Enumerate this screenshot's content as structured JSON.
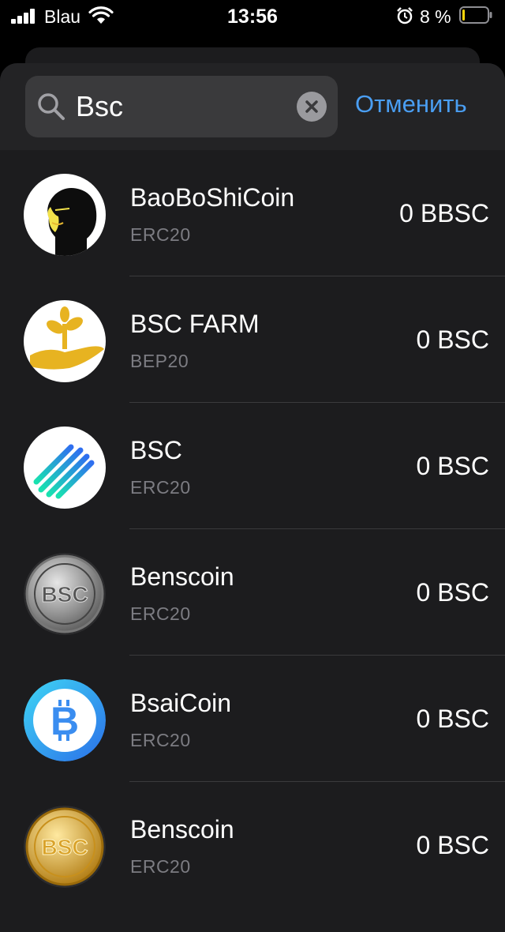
{
  "status_bar": {
    "carrier": "Blau",
    "time": "13:56",
    "battery_percent": "8 %",
    "battery_level": 0.08,
    "battery_color": "#ffd60a"
  },
  "search": {
    "value": "Bsc",
    "cancel_label": "Отменить"
  },
  "accent_color": "#4a9ef2",
  "tokens": [
    {
      "name": "BaoBoShiCoin",
      "standard": "ERC20",
      "balance": "0 BBSC",
      "icon": "baoboshicoin-icon"
    },
    {
      "name": "BSC FARM",
      "standard": "BEP20",
      "balance": "0 BSC",
      "icon": "bsc-farm-icon"
    },
    {
      "name": "BSC",
      "standard": "ERC20",
      "balance": "0 BSC",
      "icon": "bsc-icon"
    },
    {
      "name": "Benscoin",
      "standard": "ERC20",
      "balance": "0 BSC",
      "icon": "benscoin-silver-icon"
    },
    {
      "name": "BsaiCoin",
      "standard": "ERC20",
      "balance": "0 BSC",
      "icon": "bsaicoin-icon"
    },
    {
      "name": "Benscoin",
      "standard": "ERC20",
      "balance": "0 BSC",
      "icon": "benscoin-gold-icon"
    }
  ]
}
